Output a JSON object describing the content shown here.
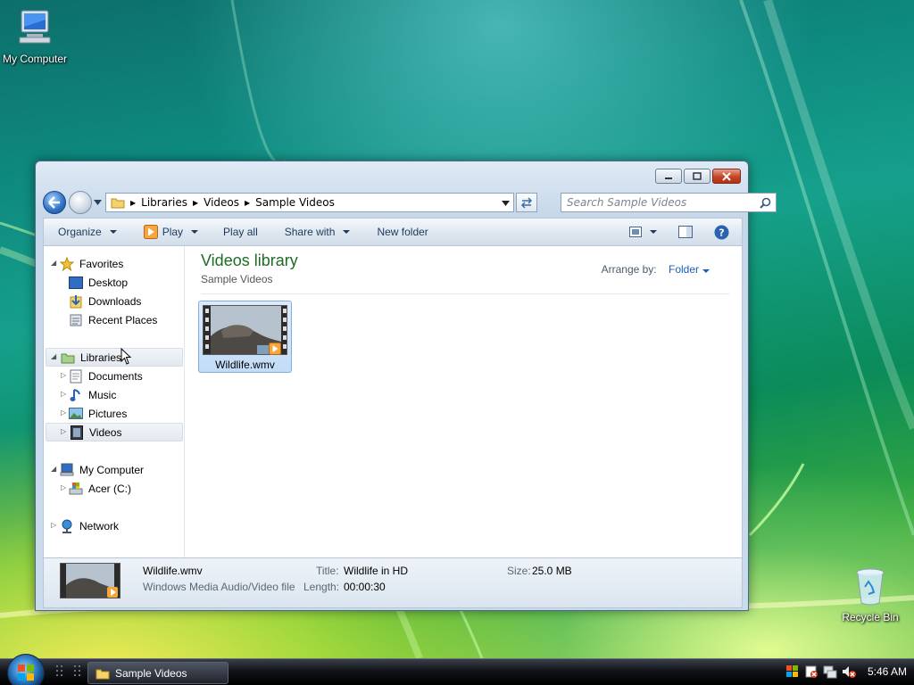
{
  "desktop": {
    "icons": [
      {
        "label": "My Computer",
        "icon": "computer-icon"
      },
      {
        "label": "Recycle Bin",
        "icon": "recycle-bin-icon"
      }
    ]
  },
  "window": {
    "breadcrumb": [
      "Libraries",
      "Videos",
      "Sample Videos"
    ],
    "search_placeholder": "Search Sample Videos",
    "toolbar": {
      "organize": "Organize",
      "play": "Play",
      "play_all": "Play all",
      "share_with": "Share with",
      "new_folder": "New folder"
    },
    "nav": {
      "favorites": "Favorites",
      "desktop": "Desktop",
      "downloads": "Downloads",
      "recent_places": "Recent Places",
      "libraries": "Libraries",
      "documents": "Documents",
      "music": "Music",
      "pictures": "Pictures",
      "videos": "Videos",
      "my_computer": "My Computer",
      "acer_c": "Acer (C:)",
      "network": "Network"
    },
    "main": {
      "title": "Videos library",
      "subtitle": "Sample Videos",
      "arrange_label": "Arrange by:",
      "arrange_value": "Folder",
      "files": [
        {
          "name": "Wildlife.wmv"
        }
      ]
    },
    "details": {
      "filename": "Wildlife.wmv",
      "type": "Windows Media Audio/Video file",
      "title_label": "Title:",
      "title_value": "Wildlife in HD",
      "length_label": "Length:",
      "length_value": "00:00:30",
      "size_label": "Size:",
      "size_value": "25.0 MB"
    }
  },
  "taskbar": {
    "task_label": "Sample Videos",
    "clock": "5:46 AM"
  },
  "colors": {
    "library_title": "#1e6c24",
    "link_blue": "#1b5fb3",
    "toolbar_text": "#1e395b"
  }
}
